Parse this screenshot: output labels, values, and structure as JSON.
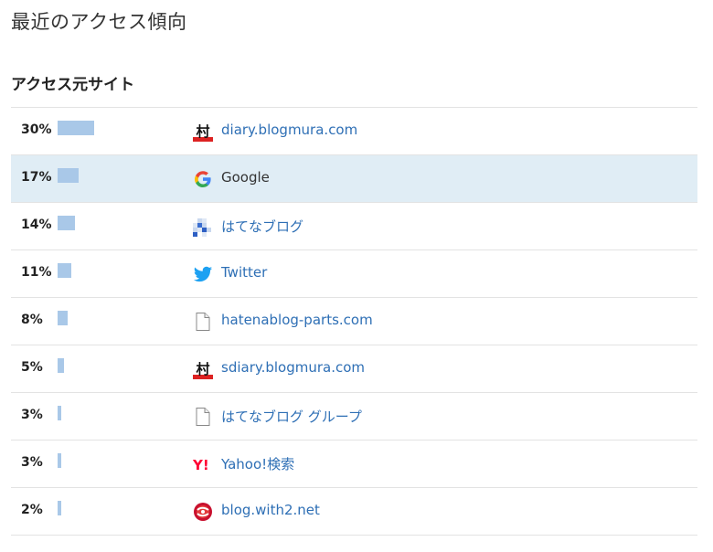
{
  "page_title": "最近のアクセス傾向",
  "section_title": "アクセス元サイト",
  "sources": [
    {
      "percent_label": "30%",
      "percent": 30,
      "site": "diary.blogmura.com",
      "icon": "blogmura-icon",
      "highlight": false,
      "plain": false
    },
    {
      "percent_label": "17%",
      "percent": 17,
      "site": "Google",
      "icon": "google-icon",
      "highlight": true,
      "plain": true
    },
    {
      "percent_label": "14%",
      "percent": 14,
      "site": "はてなブログ",
      "icon": "hatena-blog-icon",
      "highlight": false,
      "plain": false
    },
    {
      "percent_label": "11%",
      "percent": 11,
      "site": "Twitter",
      "icon": "twitter-icon",
      "highlight": false,
      "plain": false
    },
    {
      "percent_label": "8%",
      "percent": 8,
      "site": "hatenablog-parts.com",
      "icon": "page-icon",
      "highlight": false,
      "plain": false
    },
    {
      "percent_label": "5%",
      "percent": 5,
      "site": "sdiary.blogmura.com",
      "icon": "blogmura-icon",
      "highlight": false,
      "plain": false
    },
    {
      "percent_label": "3%",
      "percent": 3,
      "site": "はてなブログ グループ",
      "icon": "page-icon",
      "highlight": false,
      "plain": false
    },
    {
      "percent_label": "3%",
      "percent": 3,
      "site": "Yahoo!検索",
      "icon": "yahoo-icon",
      "highlight": false,
      "plain": false
    },
    {
      "percent_label": "2%",
      "percent": 2,
      "site": "blog.with2.net",
      "icon": "with2-icon",
      "highlight": false,
      "plain": false
    }
  ],
  "colors": {
    "bar": "#a9c8e8",
    "link": "#2e6fb5",
    "highlight_row": "#e0edf5"
  }
}
